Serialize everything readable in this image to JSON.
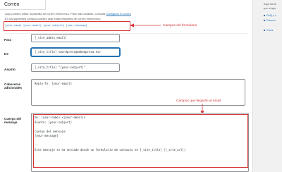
{
  "form": {
    "tab_label": "Correo",
    "info_line1": "Aquí puedes editar la plantilla de correo electrónico. Para más detalles, consulta",
    "info_link": "Configurar el correo",
    "info_line2": "En los siguientes campos puedes usar estas etiquetas de correo electrónico:",
    "mail_tags": "[your-name] [your-email] [your-subject] [your-message]",
    "to_label": "Para",
    "to_value": "[_site_admin_email]",
    "from_label": "De",
    "from_value": "[_site_title] <wordpress@webempresa.es>",
    "subject_label": "Asunto",
    "subject_value": "[_site_title] \"[your-subject]\"",
    "headers_label_line1": "Cabeceras",
    "headers_label_line2": "adicionales",
    "headers_value": "Reply-To: [your-email]",
    "body_label_line1": "Cuerpo del",
    "body_label_line2": "mensaje",
    "body_lines": [
      "De: [your-name] <[your-email]>",
      "Asunto: [your-subject]",
      "",
      "Cuerpo del mensaje:",
      "[your-message]",
      "",
      "--",
      "Este mensaje se ha enviado desde un formulario de contacto en [_site_title] ([_site_url])"
    ]
  },
  "annotations": {
    "form_fields": "Campos del formulario",
    "email_fields": "Campos que llegarán al email"
  },
  "sidebar": {
    "intro_line1": "Aquí tiene",
    "intro_line2": "por si ayu",
    "links": [
      "FAQ y c",
      "Docum"
    ],
    "extra": "Cons"
  },
  "colors": {
    "accent": "#2271b1",
    "annotation": "#d63638"
  }
}
